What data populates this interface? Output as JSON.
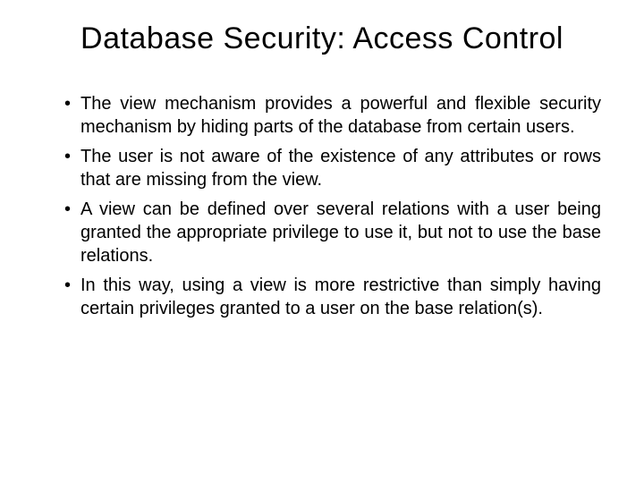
{
  "title": "Database Security: Access Control",
  "bullets": [
    "The view mechanism provides a powerful and flexible security mechanism by hiding parts of the database from certain users.",
    "The user is not aware of the existence of any attributes or rows that are missing from the view.",
    "A view can be defined over several relations with a user being granted the appropriate privilege to use it, but not to use the base relations.",
    "In this way, using a view is more restrictive than simply having certain privileges granted to a user on the base relation(s)."
  ]
}
